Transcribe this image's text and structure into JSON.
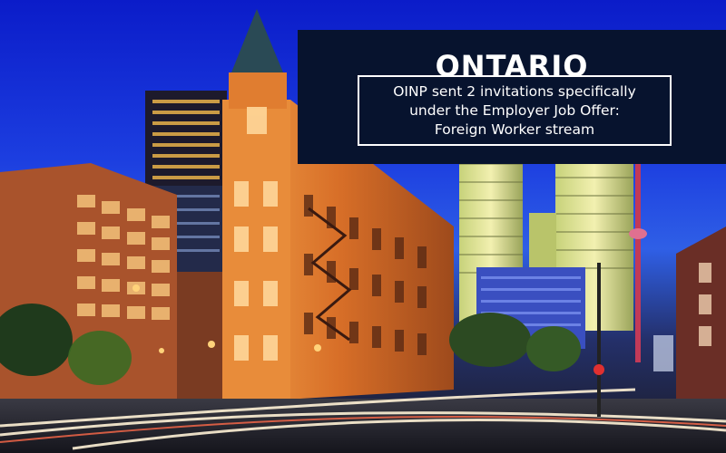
{
  "banner": {
    "title": "ONTARIO",
    "subtitle": "OINP sent 2 invitations specifically\nunder the Employer Job Offer:\nForeign Worker stream"
  },
  "scene": {
    "description_colors": {
      "sky": "#1f44e0",
      "banner": "#07132e",
      "building": "#d9762c"
    }
  }
}
